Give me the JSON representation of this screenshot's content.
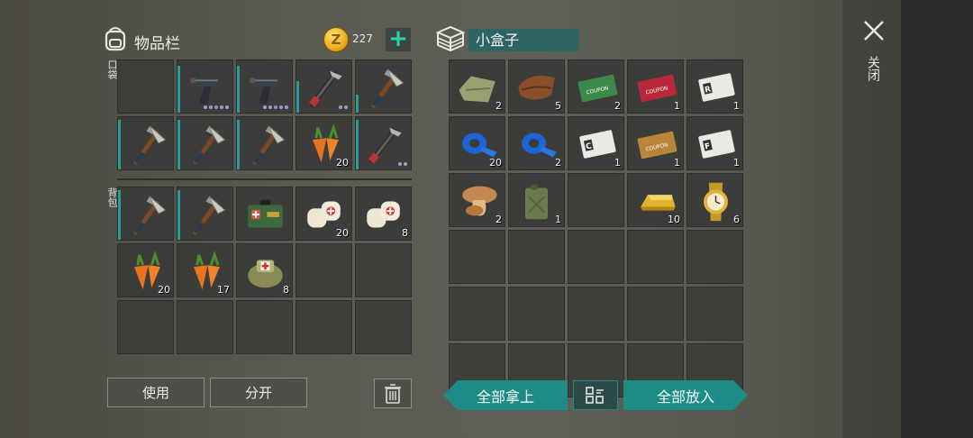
{
  "inventory": {
    "title": "物品栏",
    "coins": "227",
    "pocket_label": "口袋",
    "backpack_label": "背包",
    "pocket_slots": [
      {
        "item": "",
        "count": ""
      },
      {
        "item": "pistol",
        "count": "",
        "bar": 0.9,
        "dots": 5
      },
      {
        "item": "pistol",
        "count": "",
        "bar": 0.9,
        "dots": 5
      },
      {
        "item": "crowbar-hammer",
        "count": "",
        "bar": 0.6,
        "dots": 2
      },
      {
        "item": "hatchet",
        "count": "",
        "bar": 0.35,
        "dots": 0
      },
      {
        "item": "hatchet",
        "count": "",
        "bar": 0.95,
        "dots": 0
      },
      {
        "item": "hatchet",
        "count": "",
        "bar": 0.95,
        "dots": 0
      },
      {
        "item": "hatchet",
        "count": "",
        "bar": 0.95,
        "dots": 0
      },
      {
        "item": "carrot",
        "count": "20"
      },
      {
        "item": "crowbar-hammer",
        "count": "",
        "bar": 0.95,
        "dots": 2
      }
    ],
    "backpack_slots": [
      {
        "item": "hatchet",
        "count": "",
        "bar": 0.95
      },
      {
        "item": "hatchet",
        "count": "",
        "bar": 0.95
      },
      {
        "item": "first-aid-kit",
        "count": ""
      },
      {
        "item": "bandage",
        "count": "20"
      },
      {
        "item": "bandage",
        "count": "8"
      },
      {
        "item": "carrot",
        "count": "20"
      },
      {
        "item": "carrot",
        "count": "17"
      },
      {
        "item": "medic-bag",
        "count": "8"
      },
      {
        "item": "",
        "count": ""
      },
      {
        "item": "",
        "count": ""
      },
      {
        "item": "",
        "count": ""
      },
      {
        "item": "",
        "count": ""
      },
      {
        "item": "",
        "count": ""
      },
      {
        "item": "",
        "count": ""
      },
      {
        "item": "",
        "count": ""
      }
    ],
    "use_label": "使用",
    "split_label": "分开"
  },
  "box": {
    "title": "小盒子",
    "slots": [
      {
        "item": "cloth",
        "count": "2"
      },
      {
        "item": "leather",
        "count": "5"
      },
      {
        "item": "ration-coupon",
        "count": "2",
        "text": "RATION COUPON"
      },
      {
        "item": "combat-coupon",
        "count": "1",
        "text": "COMBAT GEAR COUPON"
      },
      {
        "item": "army-card-r",
        "count": "1",
        "text": "R"
      },
      {
        "item": "blue-tape",
        "count": "20"
      },
      {
        "item": "blue-tape",
        "count": "2"
      },
      {
        "item": "army-card-c",
        "count": "1",
        "text": "C"
      },
      {
        "item": "chemical-coupon",
        "count": "1",
        "text": "COUPON"
      },
      {
        "item": "army-card-f",
        "count": "1",
        "text": "F"
      },
      {
        "item": "mushroom",
        "count": "2"
      },
      {
        "item": "jerrycan",
        "count": "1"
      },
      {
        "item": "",
        "count": ""
      },
      {
        "item": "gold-bar",
        "count": "10"
      },
      {
        "item": "gold-watch",
        "count": "6"
      },
      {
        "item": "",
        "count": ""
      },
      {
        "item": "",
        "count": ""
      },
      {
        "item": "",
        "count": ""
      },
      {
        "item": "",
        "count": ""
      },
      {
        "item": "",
        "count": ""
      },
      {
        "item": "",
        "count": ""
      },
      {
        "item": "",
        "count": ""
      },
      {
        "item": "",
        "count": ""
      },
      {
        "item": "",
        "count": ""
      },
      {
        "item": "",
        "count": ""
      },
      {
        "item": "",
        "count": ""
      },
      {
        "item": "",
        "count": ""
      },
      {
        "item": "",
        "count": ""
      },
      {
        "item": "",
        "count": ""
      },
      {
        "item": "",
        "count": ""
      }
    ],
    "take_all_label": "全部拿上",
    "put_all_label": "全部放入"
  },
  "close_label": "关闭",
  "colors": {
    "accent": "#1f8b86",
    "plus": "#2bd3b0",
    "durability": "#2a9a9a"
  }
}
